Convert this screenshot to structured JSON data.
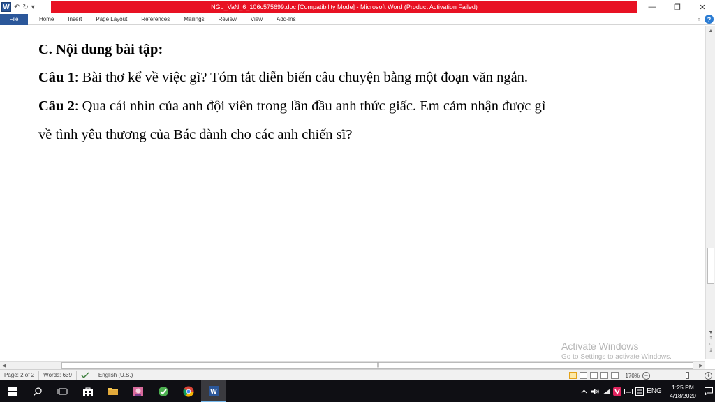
{
  "window": {
    "title": "NGu_VaN_6_106c575699.doc [Compatibility Mode] - Microsoft Word (Product Activation Failed)"
  },
  "quick_access": {
    "logo": "W",
    "undo": "↶",
    "redo": "↻",
    "customize": "▾"
  },
  "window_controls": {
    "minimize": "—",
    "restore": "❐",
    "close": "✕"
  },
  "ribbon": {
    "tabs": [
      "File",
      "Home",
      "Insert",
      "Page Layout",
      "References",
      "Mailings",
      "Review",
      "View",
      "Add-Ins"
    ],
    "expand": "▿",
    "help": "?"
  },
  "document": {
    "heading": "C. Nội dung bài tập:",
    "q1_label": "Câu 1",
    "q1_text": ":  Bài thơ kể về việc gì? Tóm tắt diễn biến câu chuyện bằng một đoạn văn ngắn.",
    "q2_label": "Câu 2",
    "q2_text": ": Qua cái nhìn của anh đội viên trong lần đầu anh thức giấc. Em cảm nhận được gì",
    "q2_text_cont": "về tình yêu thương của Bác dành cho các anh chiến sĩ?"
  },
  "watermark": {
    "line1": "Activate Windows",
    "line2": "Go to Settings to activate Windows."
  },
  "statusbar": {
    "page": "Page: 2 of 2",
    "words": "Words: 639",
    "language": "English (U.S.)",
    "zoom": "170%",
    "zoom_level": 0.72
  },
  "scroll": {
    "up": "▲",
    "down": "▼",
    "left": "◀",
    "right": "▶",
    "grip": "|||",
    "prev_page": "⤒",
    "browse": "○",
    "next_page": "⤓"
  },
  "taskbar": {
    "tray_language": "ENG",
    "time": "1:25 PM",
    "date": "4/18/2020"
  },
  "colors": {
    "title_bar_alert": "#e81123",
    "file_tab": "#2b579a",
    "taskbar": "#0f0f14"
  }
}
